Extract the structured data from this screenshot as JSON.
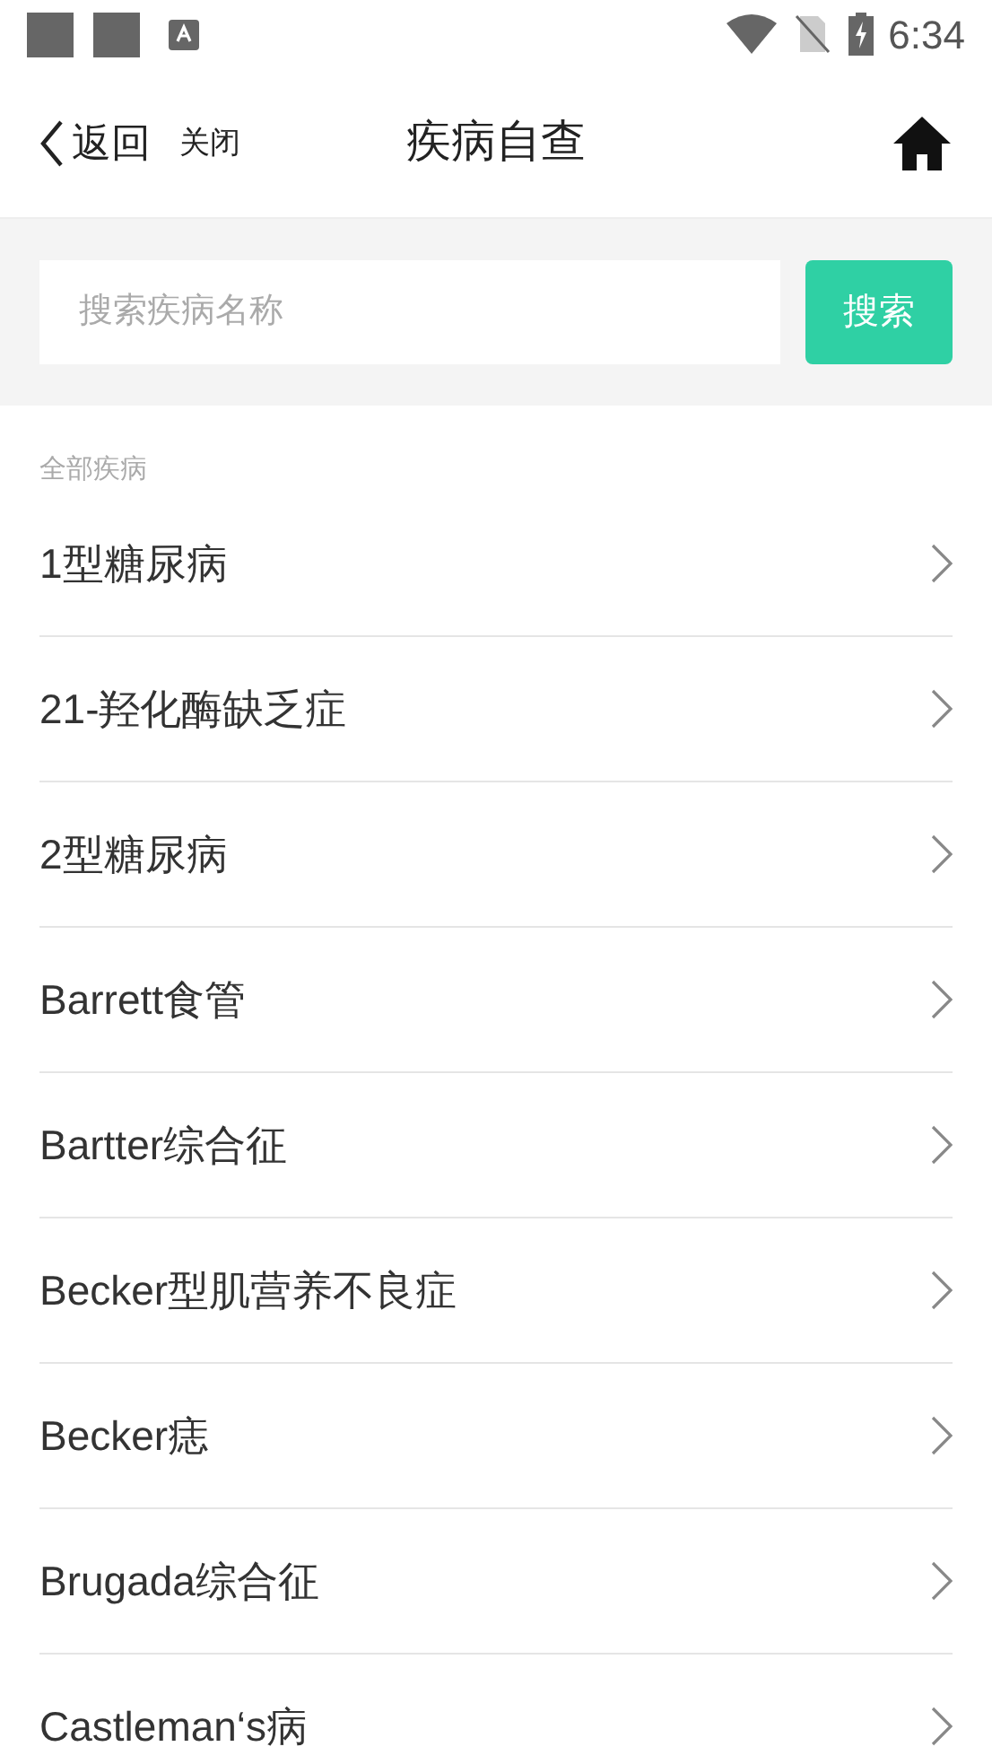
{
  "status_bar": {
    "time": "6:34"
  },
  "header": {
    "back": "返回",
    "close": "关闭",
    "title": "疾病自查"
  },
  "search": {
    "placeholder": "搜索疾病名称",
    "button": "搜索"
  },
  "section": {
    "label": "全部疾病"
  },
  "diseases": [
    {
      "name": "1型糖尿病"
    },
    {
      "name": "21-羟化酶缺乏症"
    },
    {
      "name": "2型糖尿病"
    },
    {
      "name": "Barrett食管"
    },
    {
      "name": "Bartter综合征"
    },
    {
      "name": "Becker型肌营养不良症"
    },
    {
      "name": "Becker痣"
    },
    {
      "name": "Brugada综合征"
    },
    {
      "name": "Castleman‘s病"
    }
  ]
}
